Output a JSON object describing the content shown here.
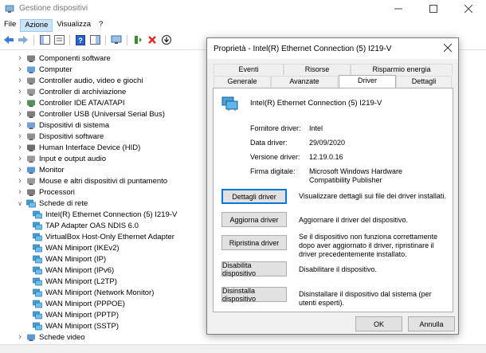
{
  "window": {
    "title": "Gestione dispositivi"
  },
  "menu": [
    "File",
    "Azione",
    "Visualizza",
    "?"
  ],
  "tree": [
    {
      "label": "Componenti software",
      "indent": 1,
      "expanded": false,
      "icon": "software-icon"
    },
    {
      "label": "Computer",
      "indent": 1,
      "expanded": false,
      "icon": "computer-icon"
    },
    {
      "label": "Controller audio, video e giochi",
      "indent": 1,
      "expanded": false,
      "icon": "speaker-icon"
    },
    {
      "label": "Controller di archiviazione",
      "indent": 1,
      "expanded": false,
      "icon": "storage-icon"
    },
    {
      "label": "Controller IDE ATA/ATAPI",
      "indent": 1,
      "expanded": false,
      "icon": "ide-icon"
    },
    {
      "label": "Controller USB (Universal Serial Bus)",
      "indent": 1,
      "expanded": false,
      "icon": "usb-icon"
    },
    {
      "label": "Dispositivi di sistema",
      "indent": 1,
      "expanded": false,
      "icon": "system-icon"
    },
    {
      "label": "Dispositivi software",
      "indent": 1,
      "expanded": false,
      "icon": "software-device-icon"
    },
    {
      "label": "Human Interface Device (HID)",
      "indent": 1,
      "expanded": false,
      "icon": "hid-icon"
    },
    {
      "label": "Input e output audio",
      "indent": 1,
      "expanded": false,
      "icon": "audio-io-icon"
    },
    {
      "label": "Monitor",
      "indent": 1,
      "expanded": false,
      "icon": "monitor-icon"
    },
    {
      "label": "Mouse e altri dispositivi di puntamento",
      "indent": 1,
      "expanded": false,
      "icon": "mouse-icon"
    },
    {
      "label": "Processori",
      "indent": 1,
      "expanded": false,
      "icon": "cpu-icon"
    },
    {
      "label": "Schede di rete",
      "indent": 1,
      "expanded": true,
      "icon": "network-icon"
    },
    {
      "label": "Intel(R) Ethernet Connection (5) I219-V",
      "indent": 2,
      "icon": "network-adapter-icon"
    },
    {
      "label": "TAP Adapter OAS NDIS 6.0",
      "indent": 2,
      "icon": "network-adapter-icon"
    },
    {
      "label": "VirtualBox Host-Only Ethernet Adapter",
      "indent": 2,
      "icon": "network-adapter-icon"
    },
    {
      "label": "WAN Miniport (IKEv2)",
      "indent": 2,
      "icon": "network-adapter-icon"
    },
    {
      "label": "WAN Miniport (IP)",
      "indent": 2,
      "icon": "network-adapter-icon"
    },
    {
      "label": "WAN Miniport (IPv6)",
      "indent": 2,
      "icon": "network-adapter-icon"
    },
    {
      "label": "WAN Miniport (L2TP)",
      "indent": 2,
      "icon": "network-adapter-icon"
    },
    {
      "label": "WAN Miniport (Network Monitor)",
      "indent": 2,
      "icon": "network-adapter-icon"
    },
    {
      "label": "WAN Miniport (PPPOE)",
      "indent": 2,
      "icon": "network-adapter-icon"
    },
    {
      "label": "WAN Miniport (PPTP)",
      "indent": 2,
      "icon": "network-adapter-icon"
    },
    {
      "label": "WAN Miniport (SSTP)",
      "indent": 2,
      "icon": "network-adapter-icon"
    },
    {
      "label": "Schede video",
      "indent": 1,
      "expanded": false,
      "icon": "display-adapter-icon"
    }
  ],
  "dialog": {
    "title": "Proprietà - Intel(R) Ethernet Connection (5) I219-V",
    "tabs_row1": [
      "Eventi",
      "Risorse",
      "Risparmio energia"
    ],
    "tabs_row2": [
      "Generale",
      "Avanzate",
      "Driver",
      "Dettagli"
    ],
    "active_tab": "Driver",
    "device_name": "Intel(R) Ethernet Connection (5) I219-V",
    "fields": [
      {
        "label": "Fornitore driver:",
        "value": "Intel"
      },
      {
        "label": "Data driver:",
        "value": "29/09/2020"
      },
      {
        "label": "Versione driver:",
        "value": "12.19.0.16"
      },
      {
        "label": "Firma digitale:",
        "value": "Microsoft Windows Hardware Compatibility Publisher"
      }
    ],
    "actions": [
      {
        "button": "Dettagli driver",
        "desc": "Visualizzare dettagli sui file dei driver installati."
      },
      {
        "button": "Aggiorna driver",
        "desc": "Aggiornare il driver del dispositivo."
      },
      {
        "button": "Ripristina driver",
        "desc": "Se il dispositivo non funziona correttamente dopo aver aggiornato il driver, ripristinare il driver precedentemente installato."
      },
      {
        "button": "Disabilita dispositivo",
        "desc": "Disabilitare il dispositivo."
      },
      {
        "button": "Disinstalla dispositivo",
        "desc": "Disinstallare il dispositivo dal sistema (per utenti esperti)."
      }
    ],
    "ok_label": "OK",
    "cancel_label": "Annulla"
  }
}
